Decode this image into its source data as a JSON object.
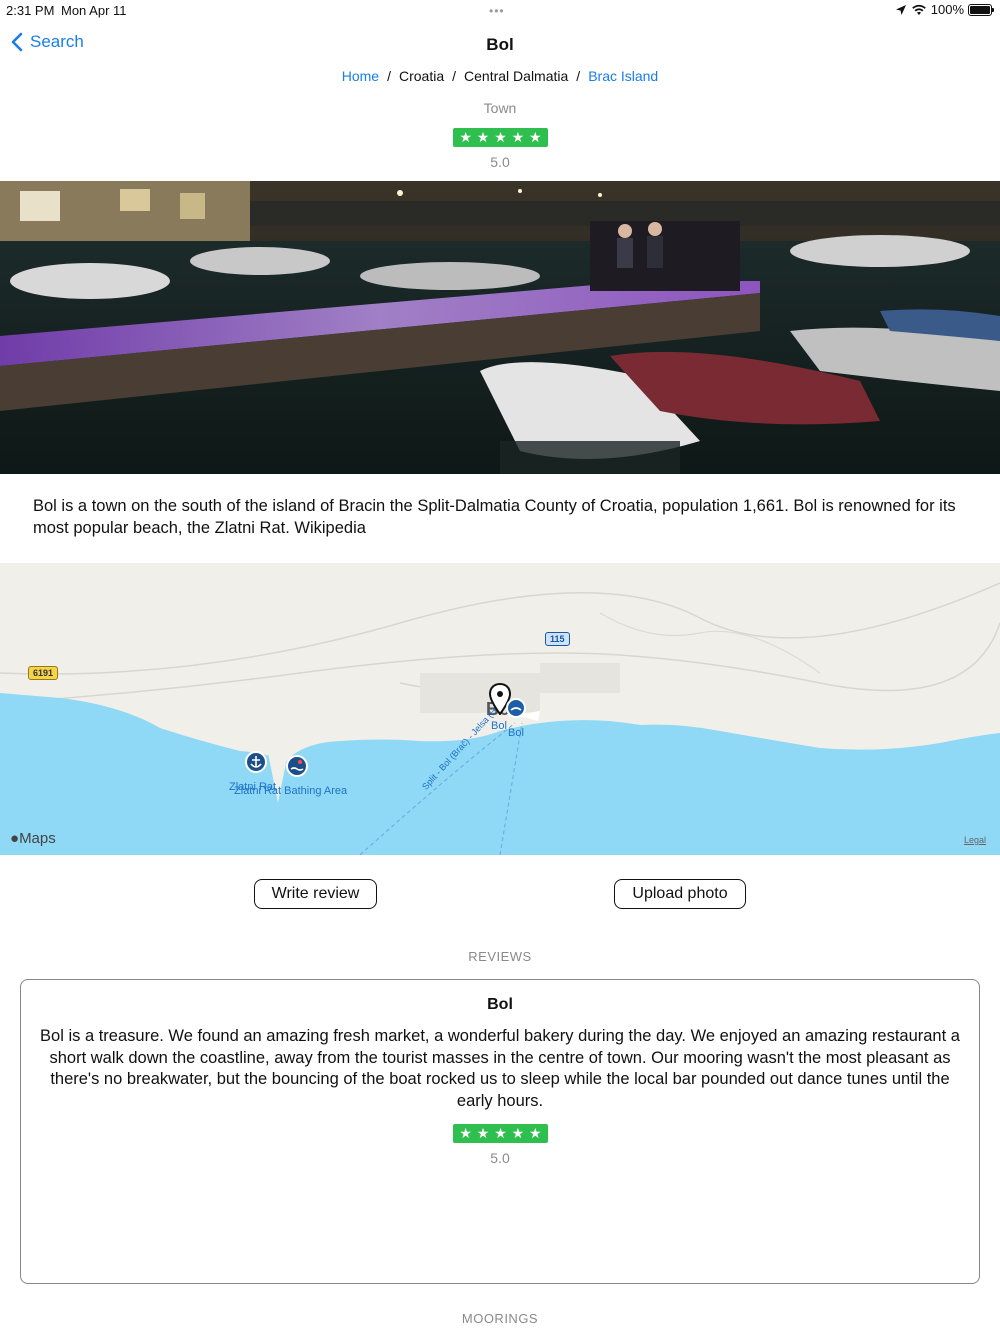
{
  "status_bar": {
    "time": "2:31 PM",
    "date": "Mon Apr 11",
    "dots": "•••",
    "battery": "100%",
    "battery_level": 1.0
  },
  "nav": {
    "back_label": "Search",
    "title": "Bol"
  },
  "breadcrumb": [
    {
      "label": "Home",
      "link": true
    },
    {
      "label": "Croatia",
      "link": false
    },
    {
      "label": "Central Dalmatia",
      "link": false
    },
    {
      "label": "Brac Island",
      "link": true
    }
  ],
  "breadcrumb_separator": "/",
  "place": {
    "type": "Town",
    "rating": "5.0",
    "stars": 5,
    "description": "Bol is a town on the south of the island of Bracin the Split-Dalmatia County of Croatia, population 1,661. Bol is renowned for its most popular beach, the Zlatni Rat. Wikipedia"
  },
  "map": {
    "road_labels": [
      "115",
      "6191"
    ],
    "place_labels": [
      "Bol",
      "Bol",
      "Zlatni Rat",
      "Zlatni Rat Bathing Area",
      "Split - Bol (Brač) - Jelsa (Hvar)"
    ],
    "town_label": "Bol",
    "logo": "Maps",
    "legal": "Legal",
    "water_color": "#8fd8f6",
    "land_color": "#f1efe9"
  },
  "actions": {
    "write_review": "Write review",
    "upload_photo": "Upload photo"
  },
  "reviews_header": "REVIEWS",
  "reviews": [
    {
      "title": "Bol",
      "text": "Bol is a treasure. We found an amazing fresh market, a wonderful bakery during the day. We enjoyed an amazing restaurant a short walk down the coastline, away from the tourist masses in the centre of town. Our mooring wasn't the most pleasant as there's no breakwater, but the bouncing of the boat rocked us to sleep while the local bar pounded out dance tunes until the early hours.",
      "rating": "5.0",
      "stars": 5
    }
  ],
  "moorings_header": "MOORINGS",
  "colors": {
    "accent": "#1a7ee8",
    "star_green": "#2fbf4e",
    "muted": "#8a8a8a"
  }
}
